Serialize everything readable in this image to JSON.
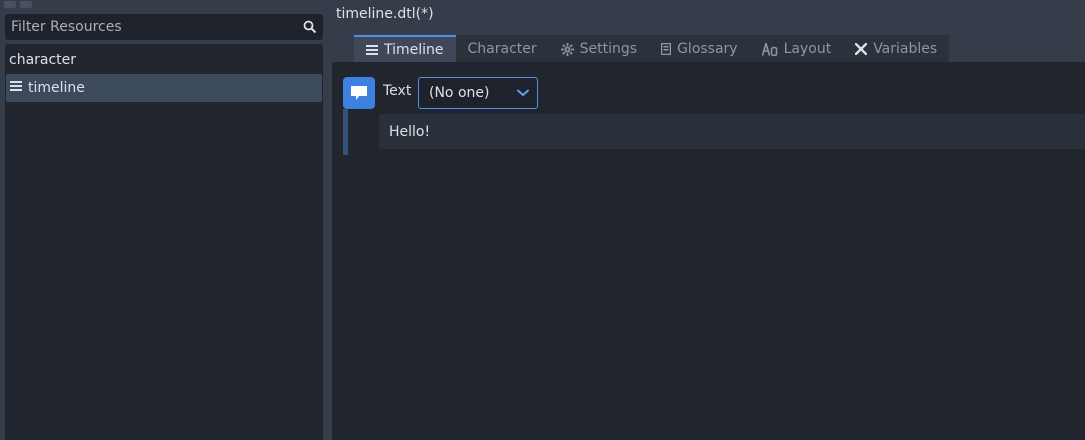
{
  "sidebar": {
    "filter_placeholder": "Filter Resources",
    "items": [
      {
        "label": "character",
        "icon": null,
        "selected": false
      },
      {
        "label": "timeline",
        "icon": "list-icon",
        "selected": true
      }
    ]
  },
  "editor": {
    "title": "timeline.dtl(*)",
    "tabs": [
      {
        "label": "Timeline",
        "icon": "list-icon",
        "active": true
      },
      {
        "label": "Character",
        "icon": null,
        "active": false
      },
      {
        "label": "Settings",
        "icon": "gear-icon",
        "active": false
      },
      {
        "label": "Glossary",
        "icon": "book-icon",
        "active": false
      },
      {
        "label": "Layout",
        "icon": "text-style-icon",
        "active": false
      },
      {
        "label": "Variables",
        "icon": "variable-x-icon",
        "active": false
      }
    ],
    "event": {
      "type_label": "Text",
      "character_value": "(No one)",
      "text_value": "Hello!"
    }
  },
  "colors": {
    "accent": "#4f8ee8",
    "event_blue": "#3d80e0",
    "panel": "#21262e",
    "background": "#363d4a"
  }
}
